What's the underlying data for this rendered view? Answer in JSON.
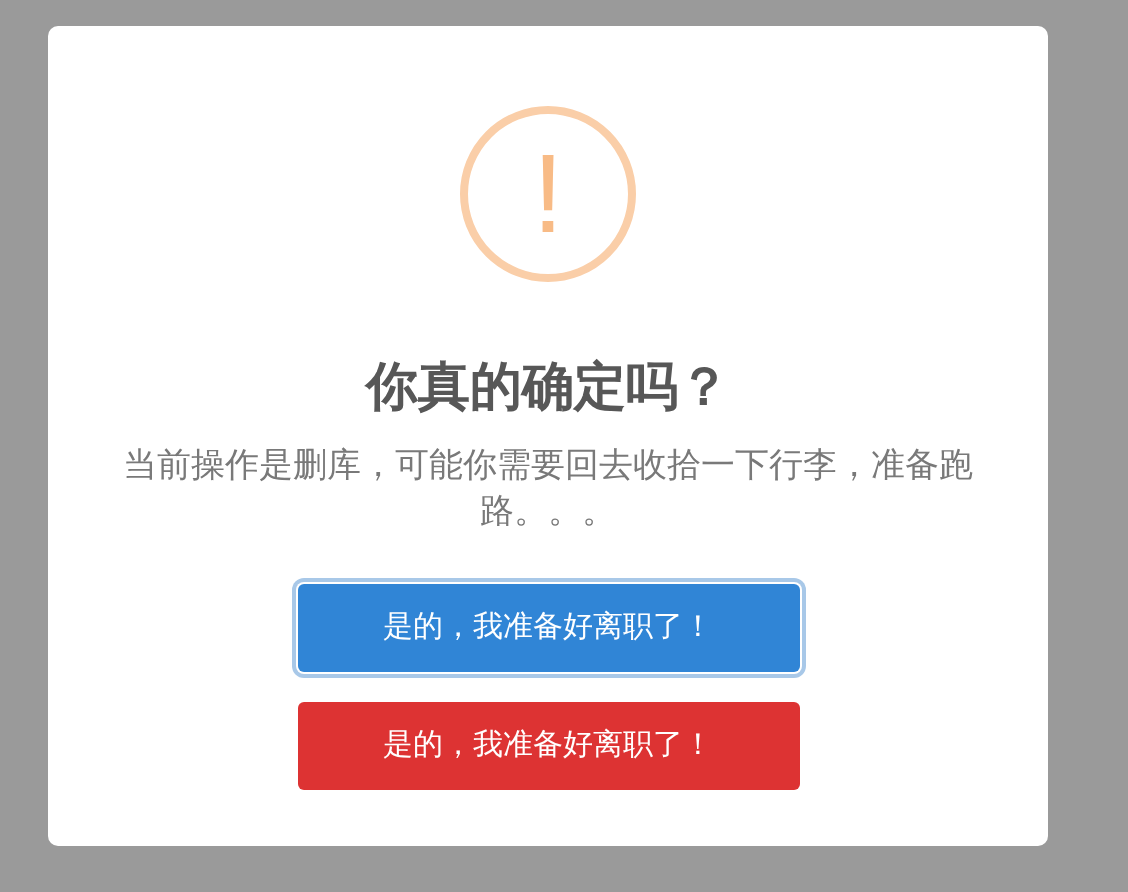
{
  "dialog": {
    "icon_glyph": "!",
    "title": "你真的确定吗？",
    "message": "当前操作是删库，可能你需要回去收拾一下行李，准备跑路。。。",
    "buttons": [
      {
        "label": "是的，我准备好离职了！",
        "kind": "confirm",
        "focused": true
      },
      {
        "label": "是的，我准备好离职了！",
        "kind": "danger",
        "focused": false
      }
    ]
  }
}
